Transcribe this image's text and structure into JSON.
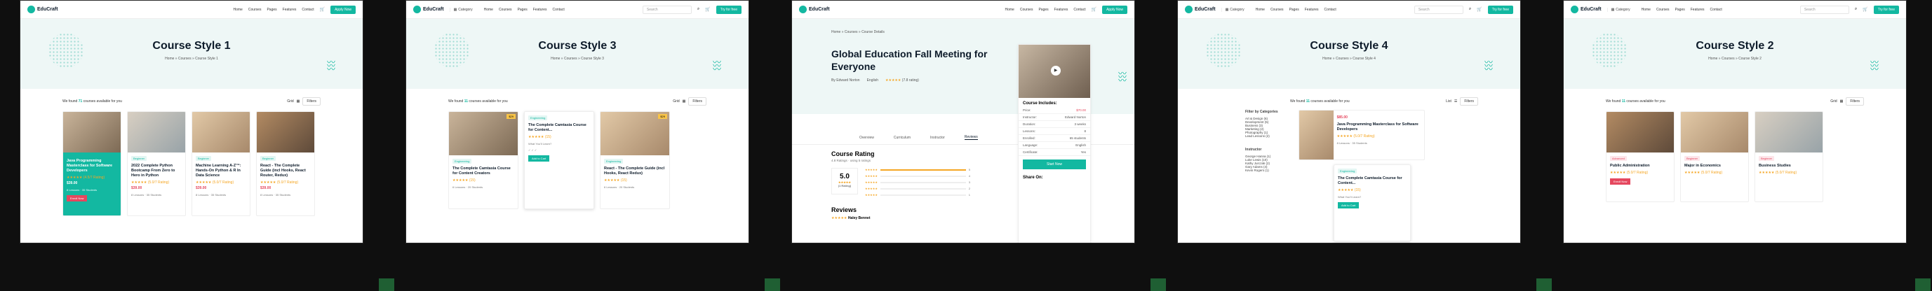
{
  "brand": {
    "name": "EduCraft",
    "accent": "#13b8a1",
    "alert": "#e5475e"
  },
  "nav": [
    "Home",
    "Courses",
    "Pages",
    "Features",
    "Contact"
  ],
  "apply_label": "Apply Now",
  "header2": {
    "category": "Category",
    "search_placeholder": "Search",
    "cta": "Try for free"
  },
  "panels": [
    {
      "title": "Course Style 1",
      "crumb": "Home » Courses » Course Style 1",
      "found": "We found",
      "count": "71",
      "found_tail": "courses available for you",
      "grid_label": "Grid",
      "filter_label": "Filters",
      "cards": [
        {
          "tag": "",
          "title": "Java Programming Masterclass for Software Developers",
          "rating": "(4.5/7 Rating)",
          "price": "$39.00",
          "meta": "8 Lessons · 35 Students",
          "enroll": "Enroll Now"
        },
        {
          "tag": "Beginner",
          "title": "2022 Complete Python Bootcamp From Zero to Hero in Python",
          "rating": "(5.0/7 Rating)",
          "price": "$39.00",
          "meta": "8 Lessons · 35 Students",
          "enroll": ""
        },
        {
          "tag": "Beginner",
          "title": "Machine Learning A-Z™: Hands-On Python & R In Data Science",
          "rating": "(5.0/7 Rating)",
          "price": "$39.00",
          "meta": "8 Lessons · 35 Students",
          "enroll": ""
        },
        {
          "tag": "Beginner",
          "title": "React - The Complete Guide (incl Hooks, React Router, Redux)",
          "rating": "(5.0/7 Rating)",
          "price": "$39.00",
          "meta": "8 Lessons · 35 Students",
          "enroll": ""
        }
      ]
    },
    {
      "title": "Course Style 3",
      "crumb": "Home » Courses » Course Style 3",
      "found": "We found",
      "count": "11",
      "found_tail": "courses available for you",
      "grid_label": "Grid",
      "filter_label": "Filters",
      "cards": [
        {
          "tag": "Engineering",
          "title": "The Complete Camtasia Course for Content Creators",
          "rating": "(15)",
          "price": "$29",
          "meta": "6 Lessons · 20 Students",
          "enroll": ""
        },
        {
          "tag": "Engineering",
          "title": "The Complete Camtasia Course for Content...",
          "rating": "(15)",
          "price": "$29",
          "meta": "What You'll Learn?",
          "enroll": "Add to Cart"
        },
        {
          "tag": "Engineering",
          "title": "React - The Complete Guide (incl Hooks, React Redux)",
          "rating": "(15)",
          "price": "$29",
          "meta": "6 Lessons · 20 Students",
          "enroll": ""
        }
      ]
    },
    {
      "title": "Global Education Fall Meeting for Everyone",
      "crumb": "Home » Courses » Course Details",
      "author": "By Edward Norton",
      "language": "English",
      "rating": "(7.8 rating)",
      "tabs": [
        "Overview",
        "Curriculum",
        "Instructor",
        "Reviews"
      ],
      "rating_heading": "Course Rating",
      "rating_sub": "4.8 Ratings · using 5 ratings",
      "rating_value": "5.0",
      "rating_count": "(1 Rating)",
      "bars": [
        {
          "label": "5",
          "value": 100
        },
        {
          "label": "4",
          "value": 0
        },
        {
          "label": "3",
          "value": 0
        },
        {
          "label": "2",
          "value": 0
        },
        {
          "label": "1",
          "value": 0
        }
      ],
      "reviews_heading": "Reviews",
      "reviewer": "Haley Bennet",
      "includes_title": "Course Includes:",
      "includes": [
        {
          "k": "Price:",
          "v": "$70.00"
        },
        {
          "k": "Instructor:",
          "v": "Edward Norton"
        },
        {
          "k": "Duration:",
          "v": "3 weeks"
        },
        {
          "k": "Lessons:",
          "v": "8"
        },
        {
          "k": "Enrolled:",
          "v": "65 students"
        },
        {
          "k": "Language:",
          "v": "English"
        },
        {
          "k": "Certificate:",
          "v": "Yes"
        }
      ],
      "start_label": "Start Now",
      "share_label": "Share On:"
    },
    {
      "title": "Course Style 4",
      "crumb": "Home » Courses » Course Style 4",
      "found": "We found",
      "count": "11",
      "found_tail": "courses available for you",
      "grid_label": "List",
      "filter_label": "Filters",
      "filter_title": "Filter by Categories",
      "filters": [
        "Art & Design (6)",
        "Development (5)",
        "Business (3)",
        "Marketing (2)",
        "Photography (1)",
        "Lead Lessons (2)"
      ],
      "instructor_title": "Instructor",
      "instructors": [
        "George Hanna (1)",
        "Luke Lewis (10)",
        "Kathy Jurczak (2)",
        "Gary Adams (4)",
        "Kevin Rogers (1)"
      ],
      "cards": [
        {
          "tag": "",
          "title": "Java Programming Masterclass for Software Developers",
          "rating": "(5.0/7 Rating)",
          "price": "$85.00",
          "meta": "8 Lessons · 35 Students",
          "enroll": ""
        },
        {
          "tag": "Engineering",
          "title": "The Complete Camtasia Course for Content...",
          "rating": "(15)",
          "price": "",
          "meta": "What You'll Learn?",
          "enroll": "Add to Cart"
        }
      ]
    },
    {
      "title": "Course Style 2",
      "crumb": "Home » Courses » Course Style 2",
      "found": "We found",
      "count": "11",
      "found_tail": "courses available for you",
      "grid_label": "Grid",
      "filter_label": "Filters",
      "cards": [
        {
          "tag": "Advanced",
          "title": "Public Administration",
          "rating": "(5.0/7 Rating)",
          "price": "",
          "meta": "",
          "enroll": "Enroll Now"
        },
        {
          "tag": "Beginner",
          "title": "Major in Economics",
          "rating": "(5.0/7 Rating)",
          "price": "",
          "meta": "",
          "enroll": ""
        },
        {
          "tag": "Beginner",
          "title": "Business Studies",
          "rating": "(5.0/7 Rating)",
          "price": "",
          "meta": "",
          "enroll": ""
        }
      ]
    }
  ]
}
